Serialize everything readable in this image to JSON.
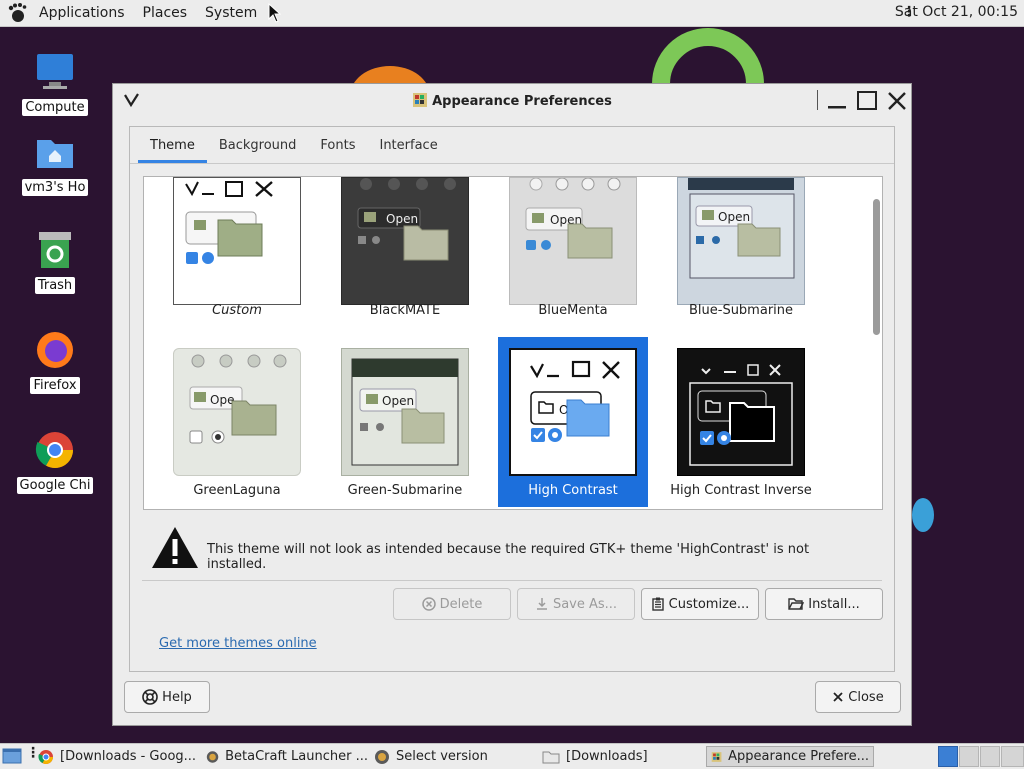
{
  "top_panel": {
    "menus": [
      "Applications",
      "Places",
      "System"
    ],
    "clock": "Sat Oct 21, 00:15"
  },
  "desktop": {
    "icons": [
      {
        "label": "Compute",
        "icon": "computer-icon"
      },
      {
        "label": "vm3's Ho",
        "icon": "home-folder-icon"
      },
      {
        "label": "Trash",
        "icon": "trash-icon"
      },
      {
        "label": "Firefox",
        "icon": "firefox-icon"
      },
      {
        "label": "Google Chi",
        "icon": "chrome-icon"
      }
    ]
  },
  "dialog": {
    "title": "Appearance Preferences",
    "tabs": [
      "Theme",
      "Background",
      "Fonts",
      "Interface"
    ],
    "active_tab": "Theme",
    "themes": [
      {
        "name": "Custom",
        "italic": true,
        "selected": false
      },
      {
        "name": "BlackMATE",
        "selected": false
      },
      {
        "name": "BlueMenta",
        "selected": false
      },
      {
        "name": "Blue-Submarine",
        "selected": false
      },
      {
        "name": "GreenLaguna",
        "selected": false
      },
      {
        "name": "Green-Submarine",
        "selected": false
      },
      {
        "name": "High Contrast",
        "selected": true
      },
      {
        "name": "High Contrast Inverse",
        "selected": false
      }
    ],
    "preview_open_label": "Open",
    "preview_open_short": "Ope",
    "preview_open_tiny": "O",
    "warning": "This theme will not look as intended because the required GTK+ theme 'HighContrast' is not installed.",
    "buttons": {
      "delete": "Delete",
      "save_as": "Save As...",
      "customize": "Customize...",
      "install": "Install..."
    },
    "more_themes_link": "Get more themes online",
    "help": "Help",
    "close": "Close"
  },
  "taskbar": {
    "tasks": [
      {
        "label": "[Downloads - Goog...",
        "icon": "chrome-icon"
      },
      {
        "label": "BetaCraft Launcher ...",
        "icon": "java-icon"
      },
      {
        "label": "Select version",
        "icon": "java-icon"
      },
      {
        "label": "[Downloads]",
        "icon": "folder-icon"
      },
      {
        "label": "Appearance Prefere...",
        "icon": "appearance-icon",
        "active": true
      }
    ]
  },
  "colors": {
    "accent": "#3584e4",
    "selection": "#1c6fdc",
    "link": "#2a6ab0",
    "desktop": "#2b1331"
  }
}
